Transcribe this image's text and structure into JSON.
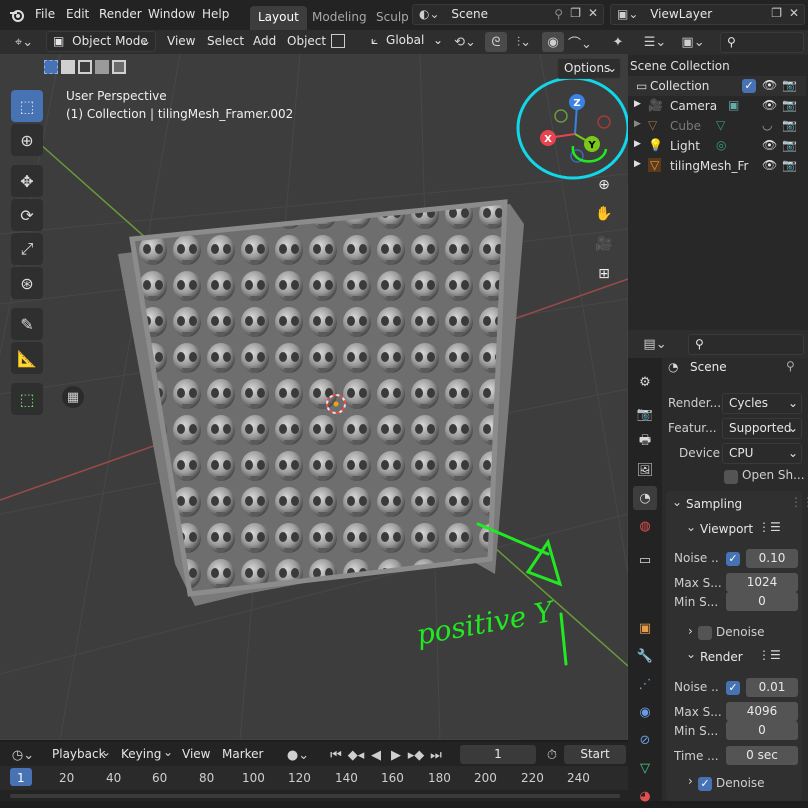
{
  "topbar": {
    "menus": [
      "File",
      "Edit",
      "Render",
      "Window",
      "Help"
    ],
    "workspaces": [
      "Layout",
      "Modeling",
      "Sculp"
    ],
    "scene_name": "Scene",
    "view_layer": "ViewLayer"
  },
  "viewport_header": {
    "mode": "Object Mode",
    "menus": [
      "View",
      "Select",
      "Add",
      "Object"
    ],
    "transform_orientation": "Global",
    "options_label": "Options"
  },
  "viewport": {
    "perspective_label": "User Perspective",
    "collection_label": "(1) Collection | tilingMesh_Framer.002",
    "annotation": "positive Y",
    "gizmo_axes": {
      "x": "X",
      "y": "Y",
      "z": "Z"
    },
    "colors": {
      "x": "#e8444f",
      "y": "#7ac81a",
      "z": "#3b83e3",
      "annotation": "#22e822",
      "circle": "#10d8e8"
    }
  },
  "outliner": {
    "title": "Scene Collection",
    "items": [
      {
        "label": "Collection",
        "icon": "collection-icon"
      },
      {
        "label": "Camera",
        "icon": "camera-icon"
      },
      {
        "label": "Cube",
        "icon": "cube-icon"
      },
      {
        "label": "Light",
        "icon": "light-icon"
      },
      {
        "label": "tilingMesh_Fr",
        "icon": "mesh-icon"
      }
    ]
  },
  "properties": {
    "context": "Scene",
    "render_engine_label": "Render...",
    "render_engine": "Cycles",
    "feature_label": "Featur...",
    "feature_value": "Supported",
    "device_label": "Device",
    "device_value": "CPU",
    "open_shading_label": "Open Sh...",
    "sampling_label": "Sampling",
    "viewport_label": "Viewport",
    "vp_noise_label": "Noise ...",
    "vp_noise_value": "0.10",
    "vp_max_label": "Max S...",
    "vp_max_value": "1024",
    "vp_min_label": "Min S...",
    "vp_min_value": "0",
    "vp_denoise_label": "Denoise",
    "render_label": "Render",
    "r_noise_label": "Noise ...",
    "r_noise_value": "0.01",
    "r_max_label": "Max S...",
    "r_max_value": "4096",
    "r_min_label": "Min S...",
    "r_min_value": "0",
    "r_time_label": "Time ...",
    "r_time_value": "0 sec",
    "r_denoise_label": "Denoise"
  },
  "timeline": {
    "menus": [
      "Playback",
      "Keying",
      "View",
      "Marker"
    ],
    "current_frame": "1",
    "start_label": "Start",
    "ruler": [
      "1",
      "20",
      "40",
      "60",
      "80",
      "100",
      "120",
      "140",
      "160",
      "180",
      "200",
      "220",
      "240"
    ]
  }
}
